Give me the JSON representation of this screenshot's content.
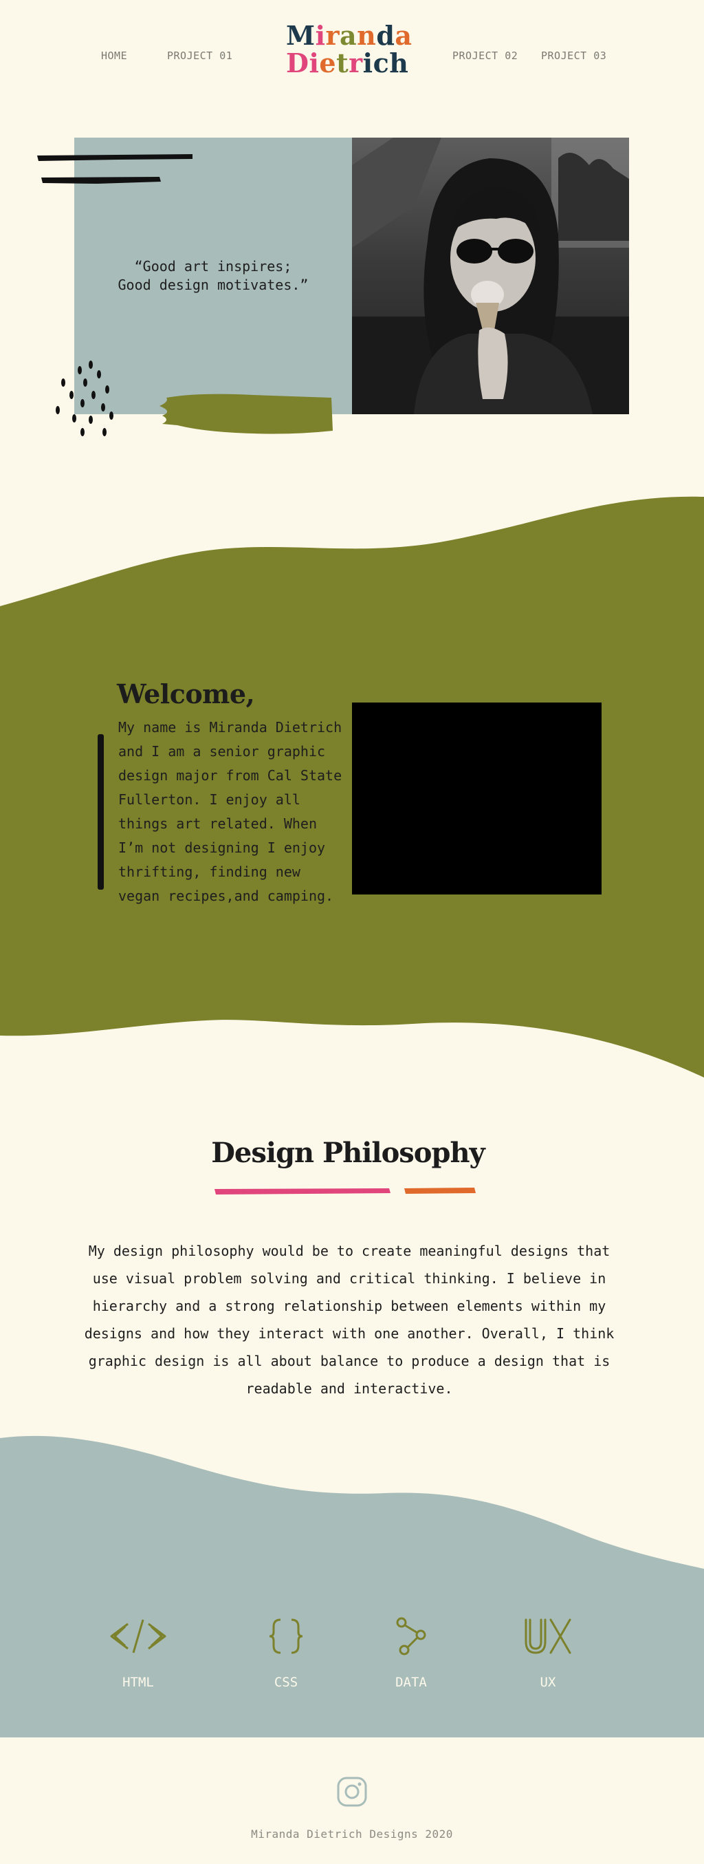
{
  "nav": {
    "home": "HOME",
    "project1": "PROJECT 01",
    "project2": "PROJECT 02",
    "project3": "PROJECT 03"
  },
  "logo": {
    "first": [
      "M",
      "i",
      "r",
      "a",
      "n",
      "d",
      "a"
    ],
    "last": [
      "D",
      "i",
      "e",
      "t",
      "r",
      "i",
      "c",
      "h"
    ],
    "first_colors": [
      "#1d3a4c",
      "#e0457b",
      "#e06a2b",
      "#7d8a32",
      "#e06a2b",
      "#1d3a4c",
      "#e06a2b"
    ],
    "last_colors": [
      "#e0457b",
      "#e0457b",
      "#e06a2b",
      "#7d8a32",
      "#e0457b",
      "#1d3a4c",
      "#1d3a4c",
      "#1d3a4c"
    ]
  },
  "hero": {
    "quote_line1": "“Good art inspires;",
    "quote_line2": "Good design motivates.”"
  },
  "welcome": {
    "title": "Welcome,",
    "body": "My name is Miranda Dietrich and I am a senior graphic design major from Cal State Fullerton. I enjoy all things art related. When I’m not designing I enjoy thrifting, finding new vegan recipes,and camping."
  },
  "philosophy": {
    "title": "Design Philosophy",
    "body": "My design philosophy would be to create meaningful designs that use visual problem solving and critical thinking. I believe in hierarchy and a strong relationship between elements within my designs and how they interact with one another. Overall, I think graphic design is all about balance to produce a design that is readable and interactive."
  },
  "skills": [
    {
      "label": "HTML",
      "icon": "code-brackets-icon"
    },
    {
      "label": "CSS",
      "icon": "curly-braces-icon"
    },
    {
      "label": "DATA",
      "icon": "data-nodes-icon"
    },
    {
      "label": "UX",
      "icon": "ux-icon"
    }
  ],
  "footer": {
    "icon": "instagram-icon",
    "text": "Miranda Dietrich Designs 2020"
  },
  "colors": {
    "background": "#fcf9ea",
    "olive": "#7c812b",
    "sage": "#a8bcba",
    "pink": "#e0457b",
    "orange": "#e06a2b",
    "navy": "#1d3a4c"
  }
}
